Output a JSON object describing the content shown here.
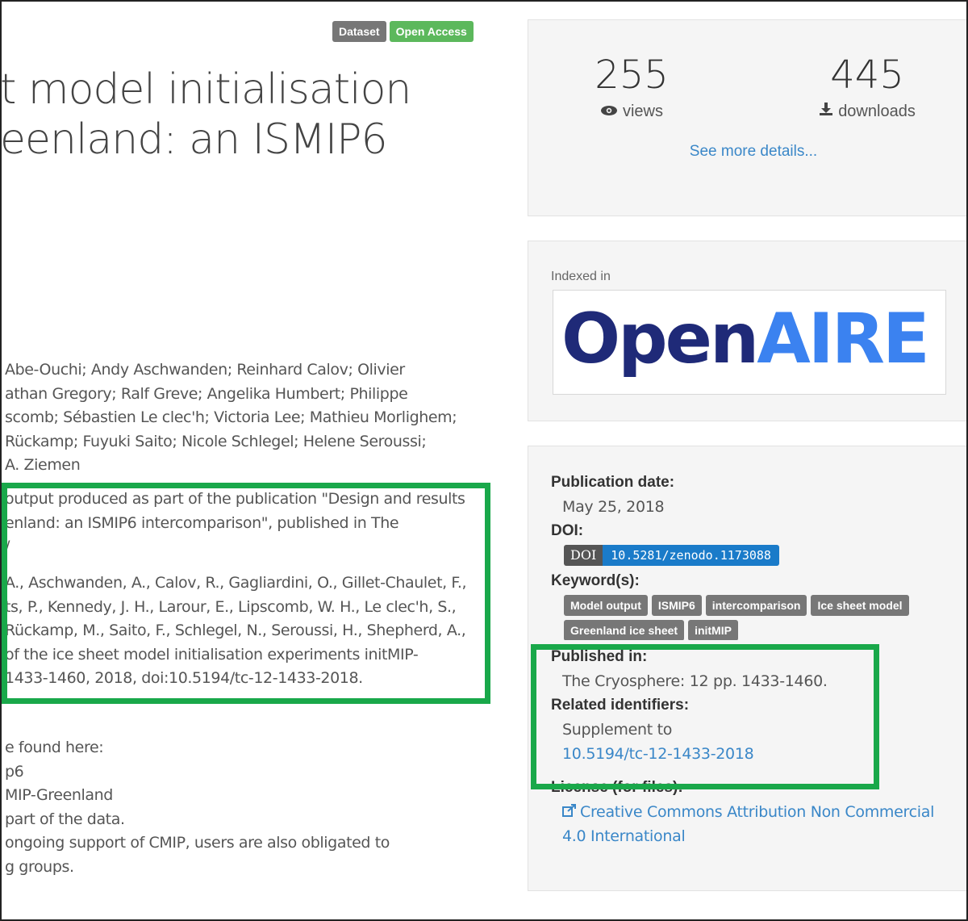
{
  "badges": {
    "dataset": "Dataset",
    "open_access": "Open Access"
  },
  "title": {
    "line1": "t model initialisation",
    "line2": "eenland: an ISMIP6"
  },
  "authors": [
    "Abe-Ouchi; Andy Aschwanden; Reinhard Calov; Olivier",
    "athan Gregory; Ralf Greve; Angelika Humbert; Philippe",
    "scomb; Sébastien Le clec'h; Victoria Lee; Mathieu Morlighem;",
    "Rückamp; Fuyuki Saito; Nicole Schlegel; Helene Seroussi;",
    "A. Ziemen"
  ],
  "description": [
    "output produced as part of the publication \"Design and results",
    "enland: an ISMIP6 intercomparison\", published in The",
    "/"
  ],
  "citation": [
    "A., Aschwanden, A., Calov, R., Gagliardini, O., Gillet-Chaulet, F.,",
    "ts, P., Kennedy, J. H., Larour, E., Lipscomb, W. H., Le clec'h, S.,",
    "Rückamp, M., Saito, F., Schlegel, N., Seroussi, H., Shepherd, A.,",
    "of the ice sheet model initialisation experiments initMIP-",
    "1433-1460, 2018, doi:10.5194/tc-12-1433-2018."
  ],
  "notes": [
    "e found here:",
    "p6",
    "MIP-Greenland",
    "part of the data.",
    "ongoing support of CMIP, users are also obligated to",
    "g groups."
  ],
  "stats": {
    "views_count": "255",
    "views_label": "views",
    "downloads_count": "445",
    "downloads_label": "downloads",
    "more_link": "See more details..."
  },
  "indexed": {
    "label": "Indexed in",
    "logo_open": "Open",
    "logo_aire": "AIRE"
  },
  "meta": {
    "pub_date_label": "Publication date:",
    "pub_date": "May 25, 2018",
    "doi_label": "DOI:",
    "doi_key": "DOI",
    "doi_value": "10.5281/zenodo.1173088",
    "keywords_label": "Keyword(s):",
    "keywords": [
      "Model output",
      "ISMIP6",
      "intercomparison",
      "Ice sheet model",
      "Greenland ice sheet",
      "initMIP"
    ],
    "published_in_label": "Published in:",
    "published_in": "The Cryosphere: 12 pp. 1433-1460.",
    "related_label": "Related identifiers:",
    "related_relation": "Supplement to",
    "related_link": "10.5194/tc-12-1433-2018",
    "license_label": "License (for files):",
    "license_line1": "Creative Commons Attribution Non Commercial",
    "license_line2": "4.0 International"
  },
  "colors": {
    "highlight": "#19a84a",
    "link": "#3a87c8",
    "open_access": "#5cb85c",
    "openaire_dark": "#1f2a78",
    "openaire_light": "#3b82f0"
  }
}
